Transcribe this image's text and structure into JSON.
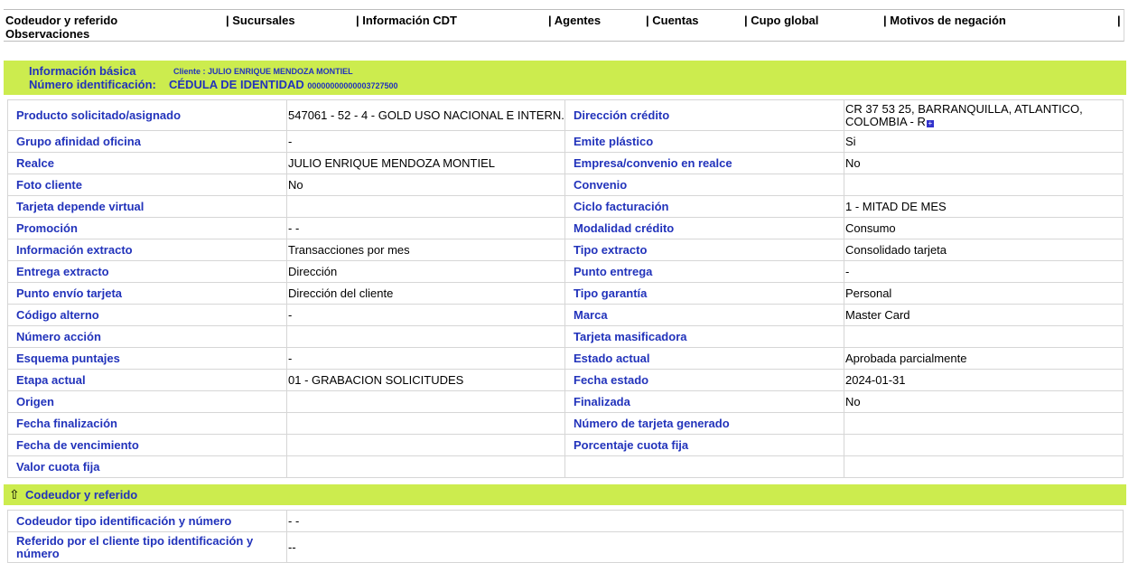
{
  "nav": {
    "items": [
      "Codeudor y referido",
      "| Sucursales",
      "| Información CDT",
      "| Agentes",
      "| Cuentas",
      "| Cupo global",
      "| Motivos de negación",
      "|",
      "Observaciones"
    ]
  },
  "banner": {
    "section_title": "Información básica",
    "client_label": "Cliente : JULIO ENRIQUE MENDOZA MONTIEL",
    "id_label": "Número identificación:",
    "id_type": "CÉDULA DE IDENTIDAD",
    "id_number": "00000000000003727500"
  },
  "info_rows": [
    {
      "l1": "Producto solicitado/asignado",
      "v1": "547061 - 52 - 4 - GOLD USO NACIONAL E INTERN.",
      "l2": "Dirección crédito",
      "v2": "CR 37 53 25, BARRANQUILLA, ATLANTICO, COLOMBIA - R"
    },
    {
      "l1": "Grupo afinidad oficina",
      "v1": "-",
      "l2": "Emite plástico",
      "v2": "Si"
    },
    {
      "l1": "Realce",
      "v1": "JULIO ENRIQUE MENDOZA MONTIEL",
      "l2": "Empresa/convenio en realce",
      "v2": "No"
    },
    {
      "l1": "Foto cliente",
      "v1": "No",
      "l2": "Convenio",
      "v2": ""
    },
    {
      "l1": "Tarjeta depende virtual",
      "v1": "",
      "l2": "Ciclo facturación",
      "v2": "1 - MITAD DE MES"
    },
    {
      "l1": "Promoción",
      "v1": "- -",
      "l2": "Modalidad crédito",
      "v2": "Consumo"
    },
    {
      "l1": "Información extracto",
      "v1": " Transacciones por mes",
      "l2": "Tipo extracto",
      "v2": " Consolidado tarjeta"
    },
    {
      "l1": "Entrega extracto",
      "v1": "Dirección",
      "l2": "Punto entrega",
      "v2": " -"
    },
    {
      "l1": "Punto envío tarjeta",
      "v1": "Dirección del cliente",
      "l2": "Tipo garantía",
      "v2": "Personal"
    },
    {
      "l1": "Código alterno",
      "v1": " -",
      "l2": "Marca",
      "v2": "Master Card"
    },
    {
      "l1": "Número acción",
      "v1": "",
      "l2": "Tarjeta masificadora",
      "v2": ""
    },
    {
      "l1": "Esquema puntajes",
      "v1": "-",
      "l2": "Estado actual",
      "v2": "Aprobada parcialmente"
    },
    {
      "l1": "Etapa actual",
      "v1": "01 - GRABACION SOLICITUDES",
      "l2": "Fecha estado",
      "v2": "2024-01-31"
    },
    {
      "l1": "Origen",
      "v1": "",
      "l2": "Finalizada",
      "v2": "No"
    },
    {
      "l1": "Fecha finalización",
      "v1": "",
      "l2": "Número de tarjeta generado",
      "v2": ""
    },
    {
      "l1": "Fecha de vencimiento",
      "v1": "",
      "l2": "Porcentaje cuota fija",
      "v2": ""
    },
    {
      "l1": "Valor cuota fija",
      "v1": "",
      "l2": "",
      "v2": ""
    }
  ],
  "codeudor": {
    "section_title": "Codeudor y referido",
    "icon": "arrow-up-icon",
    "rows": [
      {
        "label": "Codeudor tipo identificación y número",
        "value": " - -"
      },
      {
        "label": "Referido por el cliente tipo identificación y número",
        "value": " --"
      }
    ]
  },
  "colors": {
    "accent_green": "#ccec4e",
    "label_blue": "#2233bb"
  }
}
